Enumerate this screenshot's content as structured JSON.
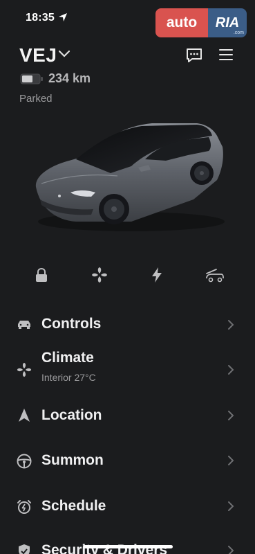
{
  "status_bar": {
    "time": "18:35",
    "location_icon": "location-arrow-icon"
  },
  "watermark": {
    "part1": "auto",
    "part2": "RIA",
    "domain": ".com"
  },
  "vehicle": {
    "name": "VEJ",
    "range": "234 km",
    "state": "Parked"
  },
  "header_icons": [
    "chat-icon",
    "menu-icon"
  ],
  "quick_actions": [
    {
      "name": "lock",
      "icon": "lock-icon"
    },
    {
      "name": "fan",
      "icon": "fan-icon"
    },
    {
      "name": "charge",
      "icon": "lightning-icon"
    },
    {
      "name": "frunk",
      "icon": "frunk-icon"
    }
  ],
  "menu": {
    "controls": {
      "label": "Controls",
      "icon": "car-icon"
    },
    "climate": {
      "label": "Climate",
      "sublabel": "Interior 27°C",
      "icon": "fan-icon"
    },
    "location": {
      "label": "Location",
      "icon": "navigation-arrow-icon"
    },
    "summon": {
      "label": "Summon",
      "icon": "steering-wheel-icon"
    },
    "schedule": {
      "label": "Schedule",
      "icon": "alarm-clock-icon"
    },
    "security": {
      "label": "Security & Drivers",
      "icon": "shield-icon"
    }
  },
  "colors": {
    "background": "#1b1c1e",
    "text": "#e9e9ea",
    "muted": "#9a9a9c",
    "car_body": "#5d6168"
  }
}
